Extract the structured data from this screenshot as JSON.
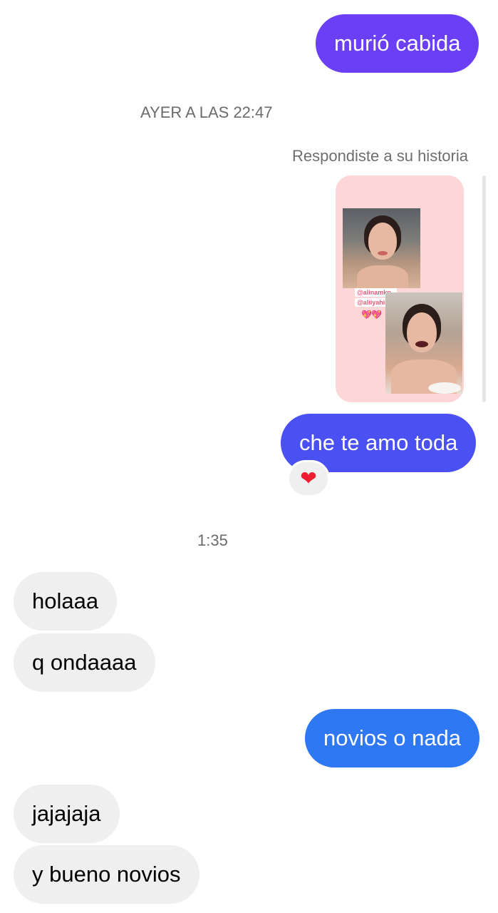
{
  "messages": {
    "m1": "murió cabida",
    "m2": "che te amo toda",
    "m3": "holaaa",
    "m4": "q ondaaaa",
    "m5": "novios o nada",
    "m6": "jajajaja",
    "m7": "y bueno novios"
  },
  "timestamps": {
    "t1": "AYER A LAS 22:47",
    "t2": "1:35"
  },
  "story_reply": {
    "label": "Respondiste a su historia",
    "tag1": "@alinamkp_",
    "tag2": "@aliiyahia",
    "hearts": "💖💖"
  },
  "reaction": {
    "emoji": "❤"
  },
  "colors": {
    "bubble_purple": "#6b3ff6",
    "bubble_indigo": "#4a50f2",
    "bubble_blue": "#2f78f4",
    "bubble_incoming": "#efefef"
  }
}
